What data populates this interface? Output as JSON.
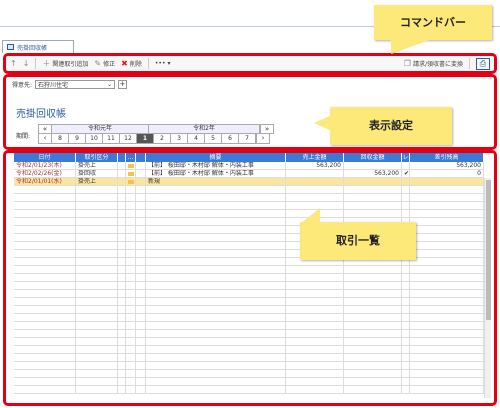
{
  "window": {
    "tab_title": "売掛回収帳"
  },
  "commandbar": {
    "up_icon": "↑",
    "down_icon": "↓",
    "add_related": "関連取引追加",
    "edit": "修正",
    "delete": "削除",
    "more": "•••",
    "convert": "請求/領収書に変換"
  },
  "settings": {
    "client_label": "得意先:",
    "client_value": "石狩川住宅",
    "ledger_title": "売掛回収帳",
    "period_label": "期間:",
    "year_prev": "令和元年",
    "year_next": "令和2年",
    "months": [
      "8",
      "9",
      "10",
      "11",
      "12",
      "1",
      "2",
      "3",
      "4",
      "5",
      "6",
      "7"
    ],
    "selected_month": "1"
  },
  "table": {
    "headers": [
      "日付",
      "取引区分",
      "",
      "…",
      "",
      "摘要",
      "売上金額",
      "回収金額",
      "レ",
      "差引残高"
    ],
    "rows": [
      {
        "date": "令和2/01/23(木)",
        "type": "掛売上",
        "ref": "【前】",
        "desc": "桜田邸・木村邸 解体・内装工事",
        "sales": "563,200",
        "receipt": "",
        "check": "",
        "balance": "563,200"
      },
      {
        "date": "令和2/02/26(金)",
        "type": "掛回収",
        "ref": "【前】",
        "desc": "桜田邸・木村邸 解体・内装工事",
        "sales": "",
        "receipt": "563,200",
        "check": "✔",
        "balance": "0"
      },
      {
        "date": "令和2/01/01(水)",
        "type": "掛売上",
        "ref": "",
        "desc": "新規",
        "sales": "",
        "receipt": "",
        "check": "",
        "balance": ""
      }
    ]
  },
  "callouts": {
    "command_bar": "コマンドバー",
    "display_settings": "表示設定",
    "transaction_list": "取引一覧"
  }
}
